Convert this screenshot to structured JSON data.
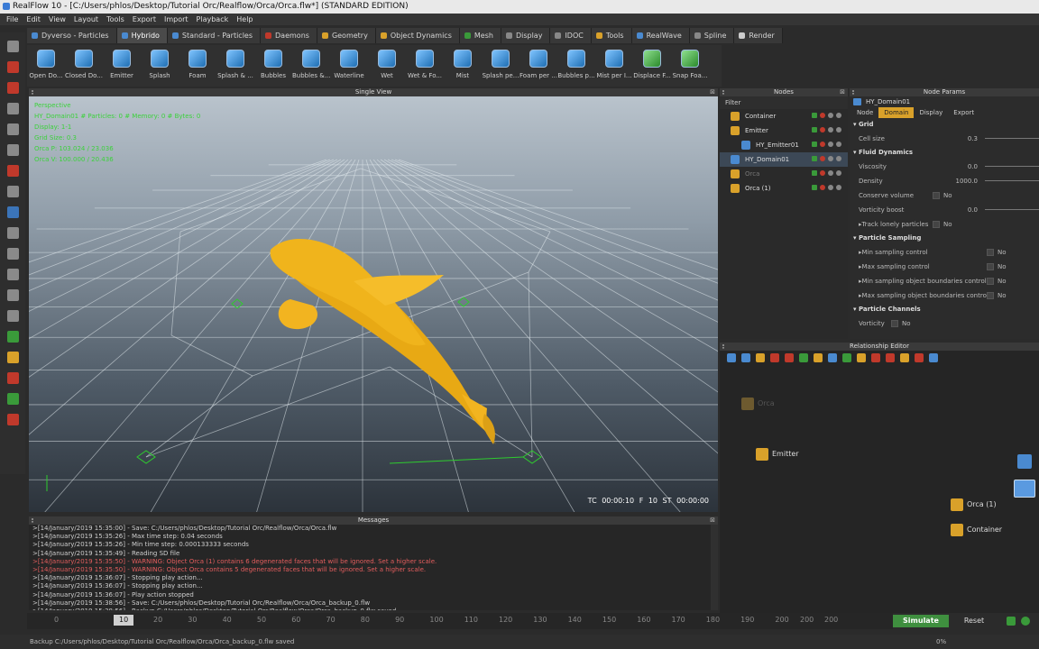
{
  "app": {
    "title": "RealFlow 10 - [C:/Users/phlos/Desktop/Tutorial Orc/Realflow/Orca/Orca.flw*] (STANDARD EDITION)"
  },
  "menu": [
    "File",
    "Edit",
    "View",
    "Layout",
    "Tools",
    "Export",
    "Import",
    "Playback",
    "Help"
  ],
  "tabs": [
    {
      "label": "Dyverso - Particles",
      "color": "#4a8ad0"
    },
    {
      "label": "Hybrido",
      "color": "#4a8ad0",
      "active": true
    },
    {
      "label": "Standard - Particles",
      "color": "#4a8ad0"
    },
    {
      "label": "Daemons",
      "color": "#c0392b"
    },
    {
      "label": "Geometry",
      "color": "#d9a12a"
    },
    {
      "label": "Object Dynamics",
      "color": "#d9a12a"
    },
    {
      "label": "Mesh",
      "color": "#3a9a3a"
    },
    {
      "label": "Display",
      "color": "#888888"
    },
    {
      "label": "IDOC",
      "color": "#888888"
    },
    {
      "label": "Tools",
      "color": "#d9a12a"
    },
    {
      "label": "RealWave",
      "color": "#4a8ad0"
    },
    {
      "label": "Spline",
      "color": "#888888"
    },
    {
      "label": "Render",
      "color": "#cccccc"
    }
  ],
  "shelf": [
    "Open Do...",
    "Closed Do...",
    "Emitter",
    "Splash",
    "Foam",
    "Splash & ...",
    "Bubbles",
    "Bubbles &...",
    "Waterline",
    "Wet",
    "Wet & Fo...",
    "Mist",
    "Splash pe...",
    "Foam per ...",
    "Bubbles p...",
    "Mist per I...",
    "Displace F...",
    "Snap Foa..."
  ],
  "viewport": {
    "title": "Single View",
    "hud": [
      "Perspective",
      "HY_Domain01 # Particles: 0 # Memory: 0 # Bytes: 0",
      "Display: 1-1",
      "Grid Size: 0.3",
      "Orca P: 103.024 / 23.036",
      "Orca V: 100.000 / 20.436"
    ],
    "timecode": "TC 00:00:10   F 10   ST 00:00:00"
  },
  "messages": {
    "title": "Messages",
    "lines": [
      {
        "t": ">[14/January/2019 15:35:00] - Save: C:/Users/phlos/Desktop/Tutorial Orc/Realflow/Orca/Orca.flw",
        "w": false
      },
      {
        "t": ">[14/January/2019 15:35:26] - Max time step: 0.04 seconds",
        "w": false
      },
      {
        "t": ">[14/January/2019 15:35:26] - Min time step: 0.000133333 seconds",
        "w": false
      },
      {
        "t": ">[14/January/2019 15:35:49] - Reading SD file",
        "w": false
      },
      {
        "t": ">[14/January/2019 15:35:50] - WARNING: Object Orca (1) contains 6 degenerated faces that will be ignored. Set a higher scale.",
        "w": true
      },
      {
        "t": ">[14/January/2019 15:35:50] - WARNING: Object Orca contains 5 degenerated faces that will be ignored. Set a higher scale.",
        "w": true
      },
      {
        "t": ">[14/January/2019 15:36:07] - Stopping play action...",
        "w": false
      },
      {
        "t": ">[14/January/2019 15:36:07] - Stopping play action...",
        "w": false
      },
      {
        "t": ">[14/January/2019 15:36:07] - Play action stopped",
        "w": false
      },
      {
        "t": ">[14/January/2019 15:38:56] - Save: C:/Users/phlos/Desktop/Tutorial Orc/Realflow/Orca/Orca_backup_0.flw",
        "w": false
      },
      {
        "t": ">[14/January/2019 15:38:56] - Backup C:/Users/phlos/Desktop/Tutorial Orc/Realflow/Orca/Orca_backup_0.flw saved",
        "w": false
      }
    ]
  },
  "nodes": {
    "title": "Nodes",
    "filter": "Filter",
    "items": [
      {
        "label": "Container",
        "indent": 0,
        "icon": "cube",
        "sel": false,
        "dim": false
      },
      {
        "label": "Emitter",
        "indent": 0,
        "icon": "cube",
        "sel": false,
        "dim": false
      },
      {
        "label": "HY_Emitter01",
        "indent": 1,
        "icon": "emitter",
        "sel": false,
        "dim": false
      },
      {
        "label": "HY_Domain01",
        "indent": 0,
        "icon": "domain",
        "sel": true,
        "dim": false
      },
      {
        "label": "Orca",
        "indent": 0,
        "icon": "cube",
        "sel": false,
        "dim": true
      },
      {
        "label": "Orca (1)",
        "indent": 0,
        "icon": "cube",
        "sel": false,
        "dim": false
      }
    ]
  },
  "params": {
    "title": "Node Params",
    "node": "HY_Domain01",
    "tabs": [
      "Node",
      "Domain",
      "Display",
      "Export"
    ],
    "active_tab": "Domain",
    "grid": "Grid",
    "cell_size_label": "Cell size",
    "cell_size": "0.3",
    "fluid": "Fluid Dynamics",
    "viscosity_label": "Viscosity",
    "viscosity": "0.0",
    "density_label": "Density",
    "density": "1000.0",
    "conserve_label": "Conserve volume",
    "vort_boost_label": "Vorticity boost",
    "vort_boost": "0.0",
    "track_label": "Track lonely particles",
    "sampling": "Particle Sampling",
    "min_samp": "Min sampling control",
    "max_samp": "Max sampling control",
    "min_obj": "Min sampling object boundaries control",
    "max_obj": "Max sampling object boundaries control",
    "channels": "Particle Channels",
    "vorticity_label": "Vorticity",
    "no": "No"
  },
  "relationship": {
    "title": "Relationship Editor",
    "nodes": [
      "Orca",
      "Emitter",
      "Orca (1)",
      "Container"
    ]
  },
  "timeline": {
    "start": "0",
    "current": "10",
    "ticks": [
      "20",
      "30",
      "40",
      "50",
      "60",
      "70",
      "80",
      "90",
      "100",
      "110",
      "120",
      "130",
      "140",
      "150",
      "160",
      "170",
      "180",
      "190",
      "200"
    ],
    "end1": "200",
    "end2": "200"
  },
  "sim": {
    "simulate": "Simulate",
    "reset": "Reset"
  },
  "status": {
    "text": "Backup C:/Users/phlos/Desktop/Tutorial Orc/Realflow/Orca/Orca_backup_0.flw saved",
    "progress": "0%"
  }
}
